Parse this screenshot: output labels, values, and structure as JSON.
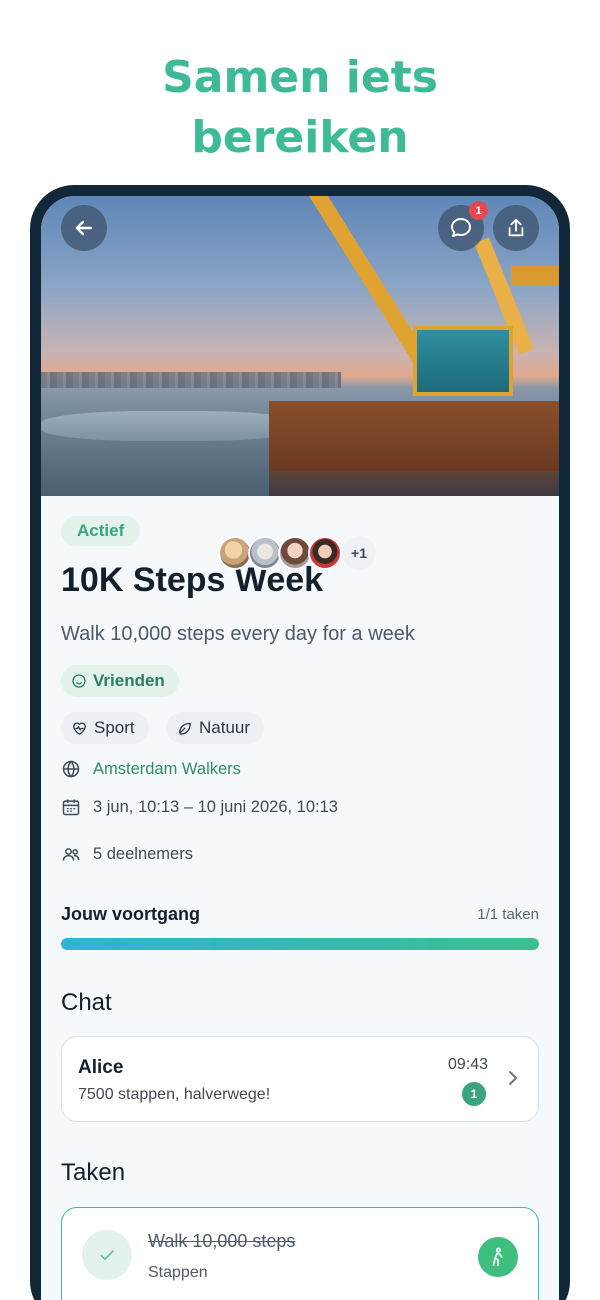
{
  "promo": {
    "headline_line1": "Samen iets",
    "headline_line2": "bereiken"
  },
  "header": {
    "chat_badge_count": "1",
    "icons": [
      "arrow-left-icon",
      "chat-bubble-icon",
      "share-icon"
    ]
  },
  "challenge": {
    "status": "Actief",
    "title": "10K Steps Week",
    "description": "Walk 10,000 steps every day for a week",
    "visibility": "Vrienden",
    "tags": [
      "Sport",
      "Natuur"
    ],
    "community": "Amsterdam Walkers",
    "date_range": "3 jun, 10:13 – 10 juni 2026, 10:13",
    "participants": "5 deelnemers",
    "more_avatars": "+1"
  },
  "progress": {
    "label": "Jouw voortgang",
    "count": "1/1 taken",
    "fraction": 1.0
  },
  "chat": {
    "section_title": "Chat",
    "preview": {
      "name": "Alice",
      "message": "7500 stappen, halverwege!",
      "time": "09:43",
      "unread": "1"
    }
  },
  "tasks": {
    "section_title": "Taken",
    "items": [
      {
        "title": "Walk 10,000 steps",
        "subtitle": "Stappen",
        "done": true
      }
    ]
  },
  "colors": {
    "accent": "#3cbf8e",
    "headline": "#3dbb99",
    "phone_frame": "#122737",
    "badge": "#e5484d"
  }
}
